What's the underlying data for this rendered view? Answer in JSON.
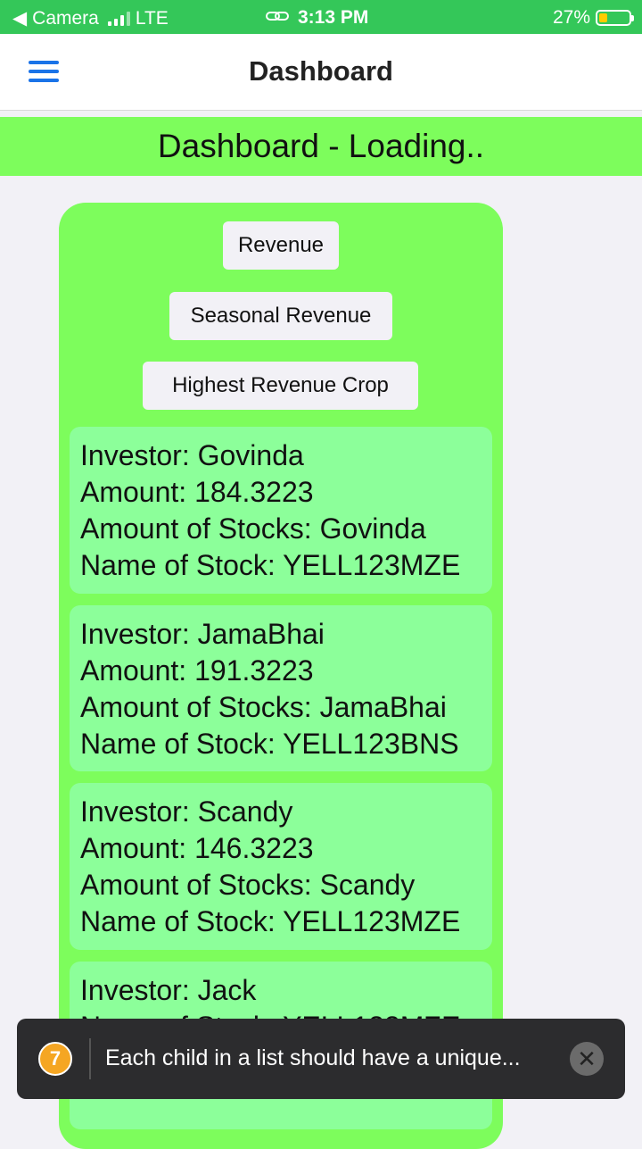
{
  "status_bar": {
    "back_label": "Camera",
    "network": "LTE",
    "time": "3:13 PM",
    "battery_percent": "27%",
    "battery_level": 0.27,
    "link_icon": "link-icon"
  },
  "header": {
    "title": "Dashboard",
    "menu_icon": "hamburger-icon"
  },
  "banner": {
    "text": "Dashboard - Loading.."
  },
  "buttons": {
    "revenue": "Revenue",
    "seasonal_revenue": "Seasonal Revenue",
    "highest_revenue_crop": "Highest Revenue Crop"
  },
  "investors": [
    {
      "investor": "Investor: Govinda",
      "amount": "Amount: 184.3223",
      "stocks": "Amount of Stocks: Govinda",
      "stock_name": "Name of Stock: YELL123MZE"
    },
    {
      "investor": "Investor: JamaBhai",
      "amount": "Amount: 191.3223",
      "stocks": "Amount of Stocks: JamaBhai",
      "stock_name": "Name of Stock: YELL123BNS"
    },
    {
      "investor": "Investor: Scandy",
      "amount": "Amount: 146.3223",
      "stocks": "Amount of Stocks: Scandy",
      "stock_name": "Name of Stock: YELL123MZE"
    },
    {
      "investor": "Investor: Jack",
      "amount": "",
      "stocks": "",
      "stock_name": "Name of Stock: YELL123MZE"
    }
  ],
  "toast": {
    "count": "7",
    "message": "Each child in a list should have a unique...",
    "close_icon": "close-icon"
  },
  "colors": {
    "status_bar": "#34c759",
    "accent_green": "#7dfd5c",
    "item_green": "#8cff9a",
    "menu_blue": "#1a73e8"
  }
}
